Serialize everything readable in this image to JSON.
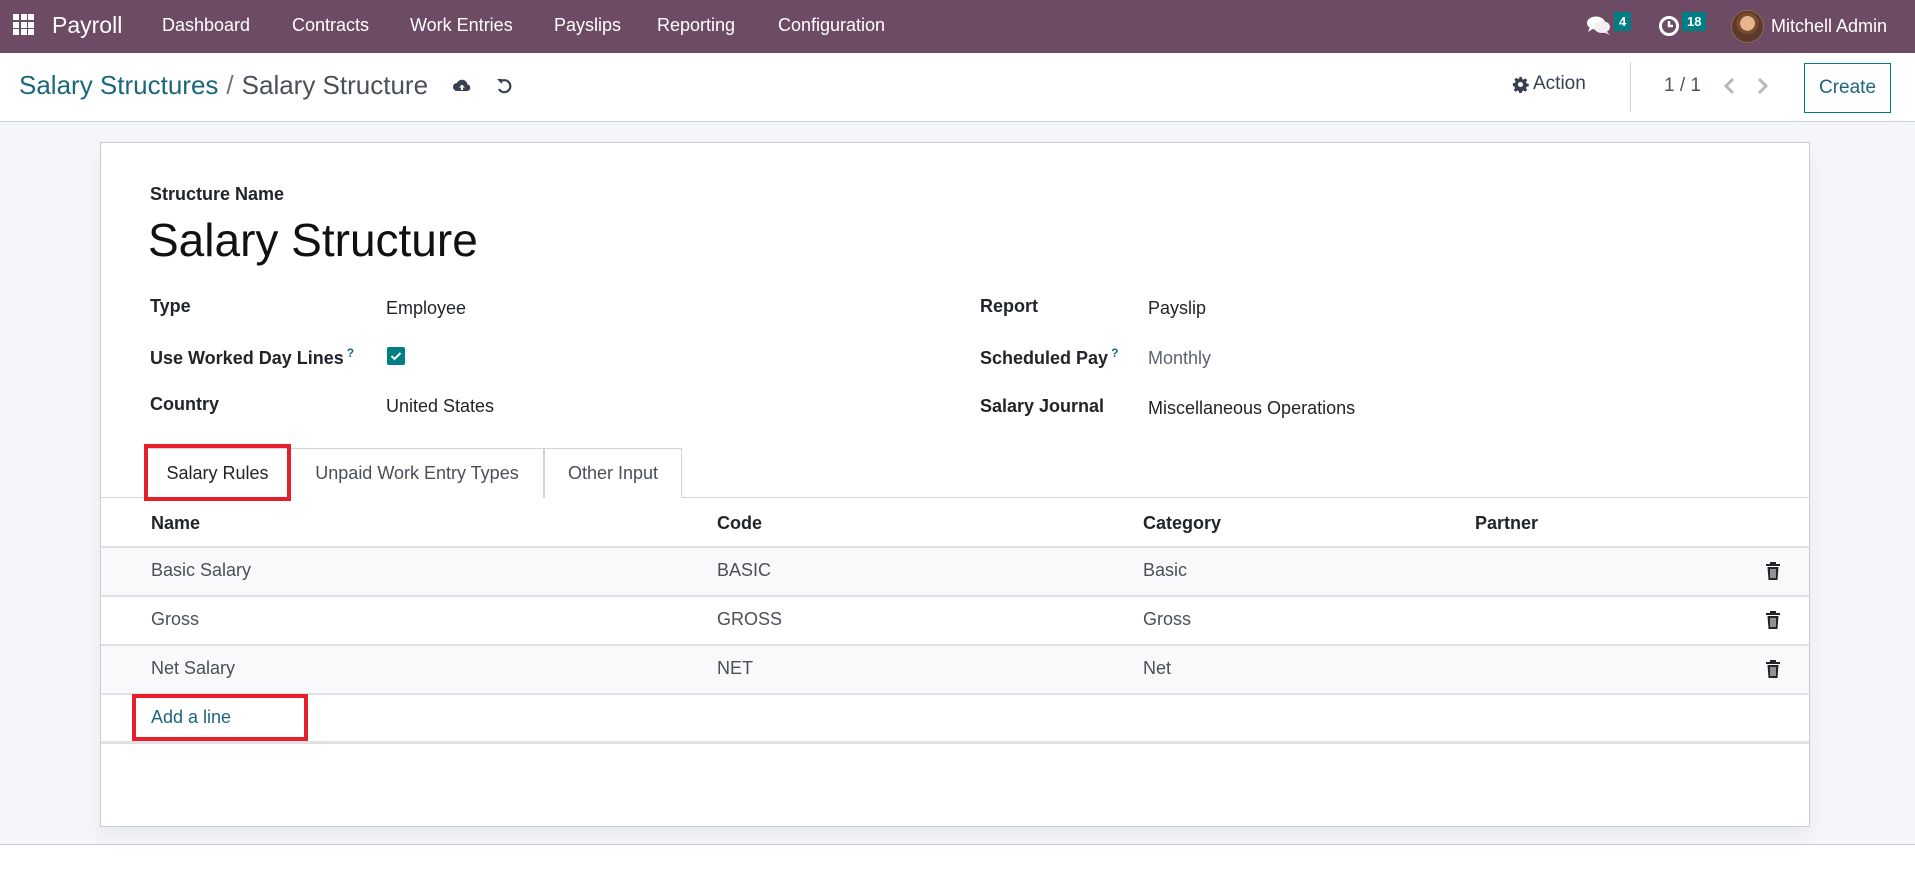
{
  "navbar": {
    "app_name": "Payroll",
    "menu": [
      "Dashboard",
      "Contracts",
      "Work Entries",
      "Payslips",
      "Reporting",
      "Configuration"
    ],
    "messages_count": "4",
    "activities_count": "18",
    "user_name": "Mitchell Admin",
    "icons": {
      "apps": "grid-icon",
      "messages": "chat-icon",
      "activities": "clock-icon"
    }
  },
  "control_panel": {
    "breadcrumb_parent": "Salary Structures",
    "breadcrumb_separator": "/",
    "breadcrumb_current": "Salary Structure",
    "action_label": "Action",
    "pager_value": "1 / 1",
    "create_label": "Create",
    "icons": {
      "save": "cloud-upload-icon",
      "discard": "undo-icon",
      "action": "gear-icon",
      "prev": "chevron-left-icon",
      "next": "chevron-right-icon"
    }
  },
  "form": {
    "structure_name_label": "Structure Name",
    "structure_name": "Salary Structure",
    "left_fields": [
      {
        "label": "Type",
        "value": "Employee"
      },
      {
        "label": "Use Worked Day Lines",
        "help": "?",
        "checked": true
      },
      {
        "label": "Country",
        "value": "United States"
      }
    ],
    "right_fields": [
      {
        "label": "Report",
        "value": "Payslip"
      },
      {
        "label": "Scheduled Pay",
        "help": "?",
        "value": "Monthly"
      },
      {
        "label": "Salary Journal",
        "value": "Miscellaneous Operations"
      }
    ]
  },
  "tabs": [
    {
      "label": "Salary Rules",
      "active": true
    },
    {
      "label": "Unpaid Work Entry Types",
      "active": false
    },
    {
      "label": "Other Input",
      "active": false
    }
  ],
  "table": {
    "columns": [
      "Name",
      "Code",
      "Category",
      "Partner"
    ],
    "rows": [
      {
        "name": "Basic Salary",
        "code": "BASIC",
        "category": "Basic",
        "partner": ""
      },
      {
        "name": "Gross",
        "code": "GROSS",
        "category": "Gross",
        "partner": ""
      },
      {
        "name": "Net Salary",
        "code": "NET",
        "category": "Net",
        "partner": ""
      }
    ],
    "add_line_label": "Add a line"
  },
  "colors": {
    "navbar": "#6d4b65",
    "accent": "#017e84",
    "link": "#1b6779",
    "highlight": "#e5202a"
  }
}
